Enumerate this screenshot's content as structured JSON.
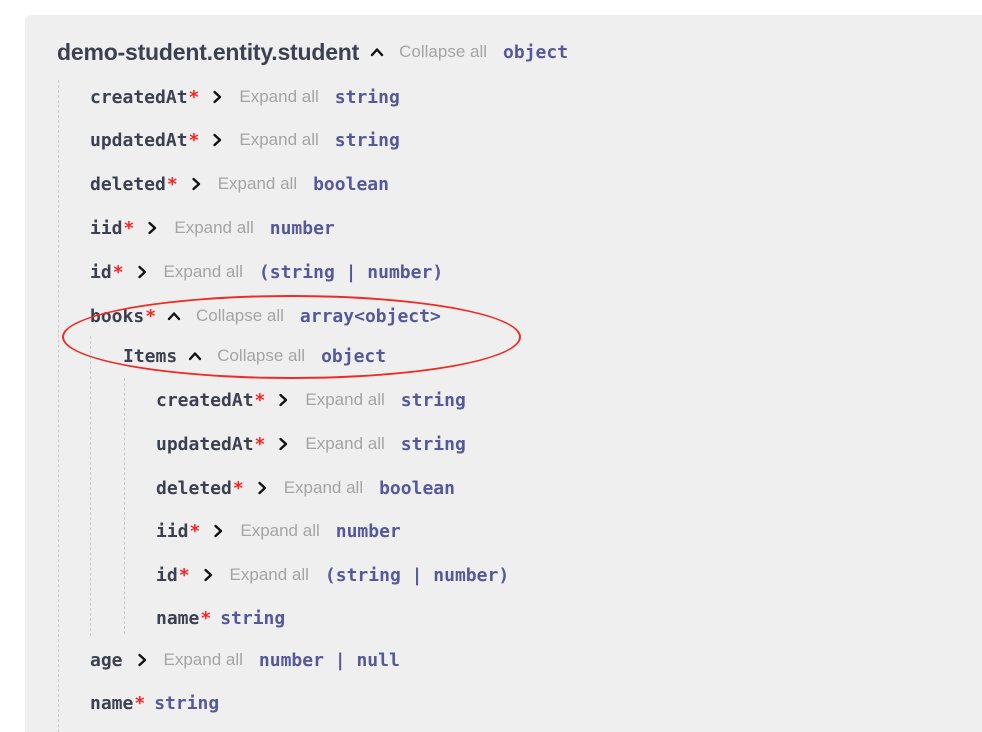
{
  "root": {
    "title": "demo-student.entity.student",
    "toggle": "Collapse all",
    "type": "object"
  },
  "properties": [
    {
      "name": "createdAt",
      "required": "*",
      "toggle": "Expand all",
      "type": "string"
    },
    {
      "name": "updatedAt",
      "required": "*",
      "toggle": "Expand all",
      "type": "string"
    },
    {
      "name": "deleted",
      "required": "*",
      "toggle": "Expand all",
      "type": "boolean"
    },
    {
      "name": "iid",
      "required": "*",
      "toggle": "Expand all",
      "type": "number"
    },
    {
      "name": "id",
      "required": "*",
      "toggle": "Expand all",
      "type": "(string | number)"
    },
    {
      "name": "books",
      "required": "*",
      "toggle": "Collapse all",
      "type": "array<object>"
    },
    {
      "name": "age",
      "required": "",
      "toggle": "Expand all",
      "type": "number | null"
    },
    {
      "name": "name",
      "required": "*",
      "type": "string"
    }
  ],
  "items": {
    "label": "Items",
    "toggle": "Collapse all",
    "type": "object",
    "properties": [
      {
        "name": "createdAt",
        "required": "*",
        "toggle": "Expand all",
        "type": "string"
      },
      {
        "name": "updatedAt",
        "required": "*",
        "toggle": "Expand all",
        "type": "string"
      },
      {
        "name": "deleted",
        "required": "*",
        "toggle": "Expand all",
        "type": "boolean"
      },
      {
        "name": "iid",
        "required": "*",
        "toggle": "Expand all",
        "type": "number"
      },
      {
        "name": "id",
        "required": "*",
        "toggle": "Expand all",
        "type": "(string | number)"
      },
      {
        "name": "name",
        "required": "*",
        "type": "string"
      }
    ]
  },
  "colors": {
    "text": "#3b4151",
    "required": "#ff2020",
    "type": "#55589b",
    "toggle": "#a4a4a4",
    "panel": "#efefef",
    "highlight": "#ef2b24"
  }
}
